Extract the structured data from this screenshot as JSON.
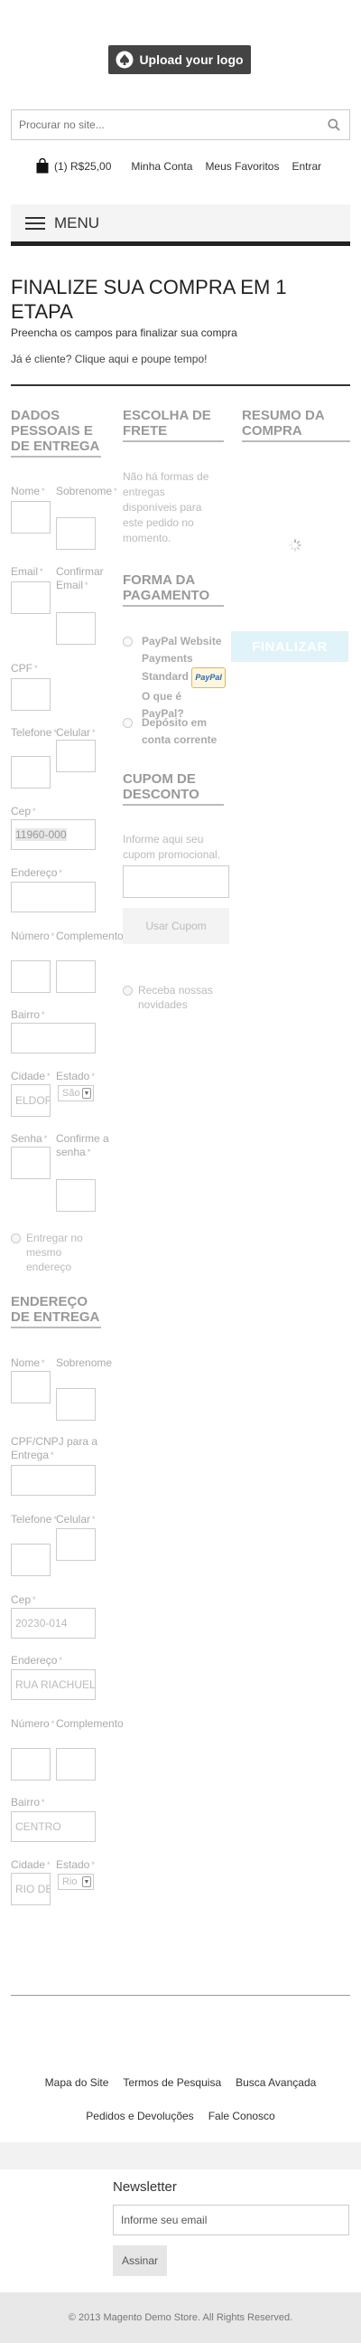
{
  "header": {
    "logo_text": "Upload your logo",
    "search_placeholder": "Procurar no site...",
    "cart_count": "(1)",
    "cart_total": "R$25,00",
    "links": [
      "Minha Conta",
      "Meus Favoritos",
      "Entrar"
    ],
    "menu_label": "MENU"
  },
  "page": {
    "title": "FINALIZE SUA COMPRA EM 1 ETAPA",
    "subtitle": "Preencha os campos para finalizar sua compra",
    "login_hint": "Já é cliente? Clique aqui e poupe tempo!"
  },
  "personal": {
    "heading": "DADOS PESSOAIS E DE ENTREGA",
    "nome": "Nome",
    "sobrenome": "Sobrenome",
    "email": "Email",
    "confirmar_email": "Confirmar Email",
    "cpf": "CPF",
    "telefone": "Telefone",
    "celular": "Celular",
    "cep": "Cep",
    "cep_value": "11960-000",
    "endereco": "Endereço",
    "numero": "Número",
    "complemento": "Complemento",
    "bairro": "Bairro",
    "cidade": "Cidade",
    "cidade_value": "ELDOR",
    "estado": "Estado",
    "estado_value": "São",
    "senha": "Senha",
    "confirme_senha": "Confirme a senha",
    "entregar_mesmo": "Entregar no mesmo endereço"
  },
  "delivery": {
    "heading": "ENDEREÇO DE ENTREGA",
    "nome": "Nome",
    "sobrenome": "Sobrenome",
    "cpf_cnpj": "CPF/CNPJ para a Entrega",
    "telefone": "Telefone",
    "celular": "Celular",
    "cep": "Cep",
    "cep_value": "20230-014",
    "endereco": "Endereço",
    "endereco_value": "RUA RIACHUELO",
    "numero": "Número",
    "complemento": "Complemento",
    "bairro": "Bairro",
    "bairro_value": "CENTRO",
    "cidade": "Cidade",
    "cidade_value": "RIO DE",
    "estado": "Estado",
    "estado_value": "Rio"
  },
  "shipping": {
    "heading": "ESCOLHA DE FRETE",
    "message": "Não há formas de entregas disponíveis para este pedido no momento."
  },
  "payment": {
    "heading": "FORMA DA PAGAMENTO",
    "paypal_label": "PayPal Website Payments Standard",
    "paypal_badge": "PayPal",
    "paypal_link": "O que é PayPal?",
    "deposito": "Depósito em conta corrente"
  },
  "coupon": {
    "heading": "CUPOM DE DESCONTO",
    "info": "Informe aqui seu cupom promocional.",
    "button": "Usar Cupom"
  },
  "newsletter_opt": "Receba nossas novidades",
  "summary": {
    "heading": "RESUMO DA COMPRA",
    "finalize_button": "FINALIZAR"
  },
  "footer": {
    "links_row1": [
      "Mapa do Site",
      "Termos de Pesquisa",
      "Busca Avançada"
    ],
    "links_row2": [
      "Pedidos e Devoluções",
      "Fale Conosco"
    ],
    "newsletter_title": "Newsletter",
    "newsletter_placeholder": "Informe seu email",
    "newsletter_button": "Assinar",
    "copyright": "© 2013 Magento Demo Store. All Rights Reserved."
  }
}
